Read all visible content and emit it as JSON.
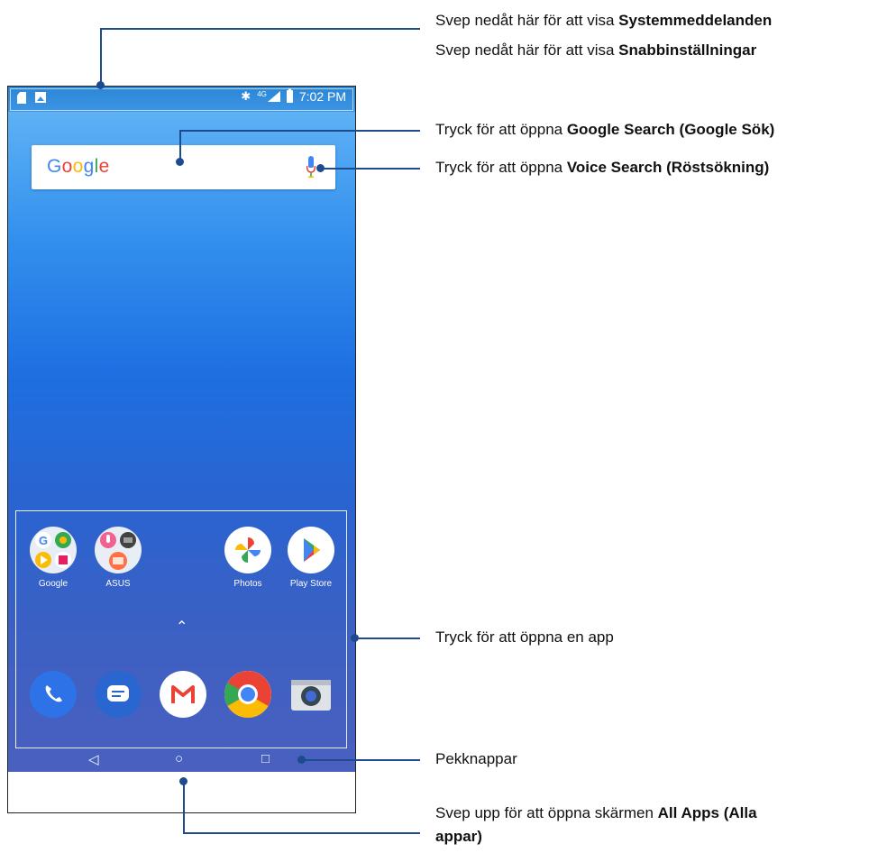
{
  "status_bar": {
    "time": "7:02 PM",
    "network": "4G"
  },
  "search": {
    "logo": "Google"
  },
  "apps": [
    {
      "label": "Google"
    },
    {
      "label": "ASUS"
    },
    {
      "label": "Photos"
    },
    {
      "label": "Play Store"
    }
  ],
  "dock": [
    "phone-icon",
    "messages-icon",
    "gmail-icon",
    "chrome-icon",
    "camera-icon"
  ],
  "nav": {
    "back": "◁",
    "home": "○",
    "recents": "□"
  },
  "chevron": "^",
  "callouts": {
    "notifications_pre": "Svep nedåt här för att visa ",
    "notifications_bold": "Systemmeddelanden",
    "quick_pre": "Svep nedåt här för att visa ",
    "quick_bold": "Snabbinställningar",
    "search_pre": "Tryck för att öppna ",
    "search_bold": "Google Search (Google Sök)",
    "voice_pre": "Tryck för att öppna ",
    "voice_bold": "Voice Search (Röstsökning)",
    "app_text": "Tryck för att öppna en app",
    "keys_text": "Pekknappar",
    "allapps_pre": "Svep upp för att öppna skärmen ",
    "allapps_bold1": "All Apps (Alla",
    "allapps_bold2": "appar)"
  }
}
